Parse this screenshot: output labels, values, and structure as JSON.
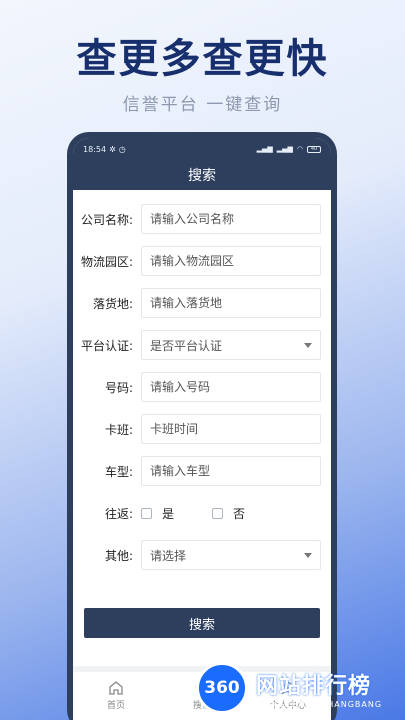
{
  "promo": {
    "headline": "查更多查更快",
    "subhead": "信誉平台  一键查询"
  },
  "status_bar": {
    "time": "18:54",
    "battery": "40"
  },
  "nav": {
    "title": "搜索"
  },
  "form": {
    "company": {
      "label": "公司名称:",
      "placeholder": "请输入公司名称"
    },
    "park": {
      "label": "物流园区:",
      "placeholder": "请输入物流园区"
    },
    "drop": {
      "label": "落货地:",
      "placeholder": "请输入落货地"
    },
    "cert": {
      "label": "平台认证:",
      "value": "是否平台认证"
    },
    "number": {
      "label": "号码:",
      "placeholder": "请输入号码"
    },
    "schedule": {
      "label": "卡班:",
      "placeholder": "卡班时间"
    },
    "model": {
      "label": "车型:",
      "placeholder": "请输入车型"
    },
    "round_trip": {
      "label": "往返:",
      "yes": "是",
      "no": "否"
    },
    "other": {
      "label": "其他:",
      "value": "请选择"
    }
  },
  "search_button": {
    "label": "搜索"
  },
  "tabbar": {
    "home": "首页",
    "search": "搜索",
    "profile": "个人中心"
  },
  "watermark": {
    "logo": "360",
    "name": "网站排行榜",
    "domain": "WANGZHANPAIHANGBANG"
  },
  "colors": {
    "primary": "#2d3f5d",
    "headline": "#17306d",
    "watermark": "#1a6cff"
  }
}
